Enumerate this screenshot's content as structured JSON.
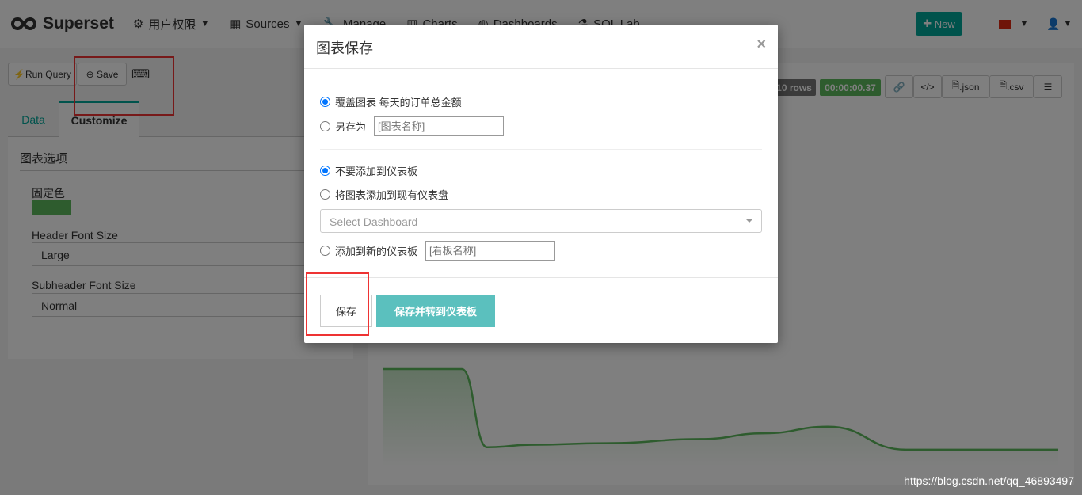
{
  "nav": {
    "brand": "Superset",
    "items": [
      {
        "label": "用户权限",
        "icon": "cogs-icon"
      },
      {
        "label": "Sources",
        "icon": "table-icon"
      },
      {
        "label": "Manage",
        "icon": "wrench-icon"
      },
      {
        "label": "Charts",
        "icon": "bar-chart-icon"
      },
      {
        "label": "Dashboards",
        "icon": "dashboard-icon"
      },
      {
        "label": "SQL Lab",
        "icon": "flask-icon"
      }
    ],
    "new_label": "New"
  },
  "toolbar": {
    "run_query": "Run Query",
    "save": "Save"
  },
  "tabs": [
    {
      "label": "Data"
    },
    {
      "label": "Customize"
    }
  ],
  "customize": {
    "section": "图表选项",
    "fixed_color_label": "固定色",
    "fixed_color": "#5cb85c",
    "header_font_label": "Header Font Size",
    "header_font_value": "Large",
    "subheader_font_label": "Subheader Font Size",
    "subheader_font_value": "Normal"
  },
  "result": {
    "rows": "10 rows",
    "time": "00:00:00.37",
    "json": ".json",
    "csv": ".csv"
  },
  "modal": {
    "title": "图表保存",
    "overwrite": "覆盖图表 每天的订单总金额",
    "save_as": "另存为",
    "save_as_placeholder": "[图表名称]",
    "no_dashboard": "不要添加到仪表板",
    "add_existing": "将图表添加到现有仪表盘",
    "select_placeholder": "Select Dashboard",
    "add_new": "添加到新的仪表板",
    "new_dash_placeholder": "[看板名称]",
    "save_btn": "保存",
    "save_go_btn": "保存并转到仪表板",
    "selected_save": "overwrite",
    "selected_dashboard": "none"
  },
  "chart_data": {
    "type": "area",
    "color": "#5cb85c",
    "x": [
      0,
      1,
      2,
      3,
      4,
      5,
      6,
      7,
      8,
      9
    ],
    "values": [
      100,
      100,
      5,
      8,
      10,
      15,
      22,
      30,
      2,
      2
    ]
  },
  "watermark": "https://blog.csdn.net/qq_46893497"
}
